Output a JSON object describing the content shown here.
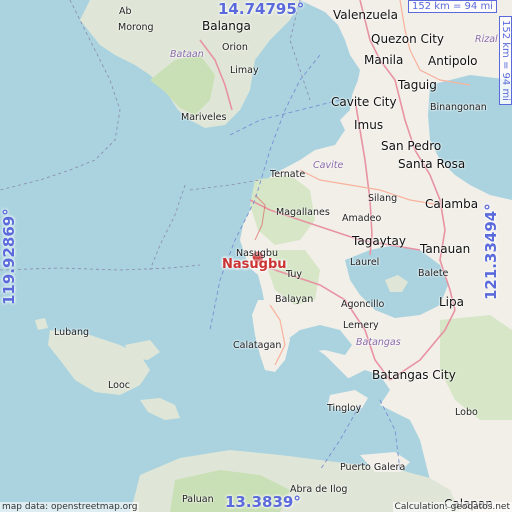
{
  "marker": {
    "name": "Nasugbu"
  },
  "coordinates": {
    "top_lat": "14.74795°",
    "bottom_lat": "13.3839°",
    "left_lon": "119.92869°",
    "right_lon": "121.33494°"
  },
  "scale": {
    "horizontal": "152 km = 94 mi",
    "vertical": "152 km = 94 mi"
  },
  "footer": {
    "attribution": "map data: openstreetmap.org",
    "credit": "Calculation: geodatos.net"
  },
  "places": {
    "ab": "Ab",
    "balanga": "Balanga",
    "morong": "Morong",
    "bataan": "Bataan",
    "orion": "Orion",
    "limay": "Limay",
    "mariveles": "Mariveles",
    "valenzuela": "Valenzuela",
    "quezon_city": "Quezon City",
    "manila": "Manila",
    "antipolo": "Antipolo",
    "rizal": "Rizal",
    "taguig": "Taguig",
    "cavite_city": "Cavite City",
    "binangonan": "Binangonan",
    "imus": "Imus",
    "san_pedro": "San Pedro",
    "santa_rosa": "Santa Rosa",
    "cavite": "Cavite",
    "ternate": "Ternate",
    "silang": "Silang",
    "calamba": "Calamba",
    "magallanes": "Magallanes",
    "amadeo": "Amadeo",
    "nasugbu_small": "Nasugbu",
    "tagaytay": "Tagaytay",
    "tanauan": "Tanauan",
    "laurel": "Laurel",
    "tuy": "Tuy",
    "balete": "Balete",
    "balayan": "Balayan",
    "agoncillo": "Agoncillo",
    "lipa": "Lipa",
    "lubang": "Lubang",
    "lemery": "Lemery",
    "calatagan": "Calatagan",
    "batangas_prov": "Batangas",
    "looc": "Looc",
    "batangas_city": "Batangas City",
    "tingloy": "Tingloy",
    "lobo": "Lobo",
    "puerto_galera": "Puerto Galera",
    "paluan": "Paluan",
    "abra_de_ilog": "Abra de Ilog",
    "calapan": "Calapan"
  }
}
